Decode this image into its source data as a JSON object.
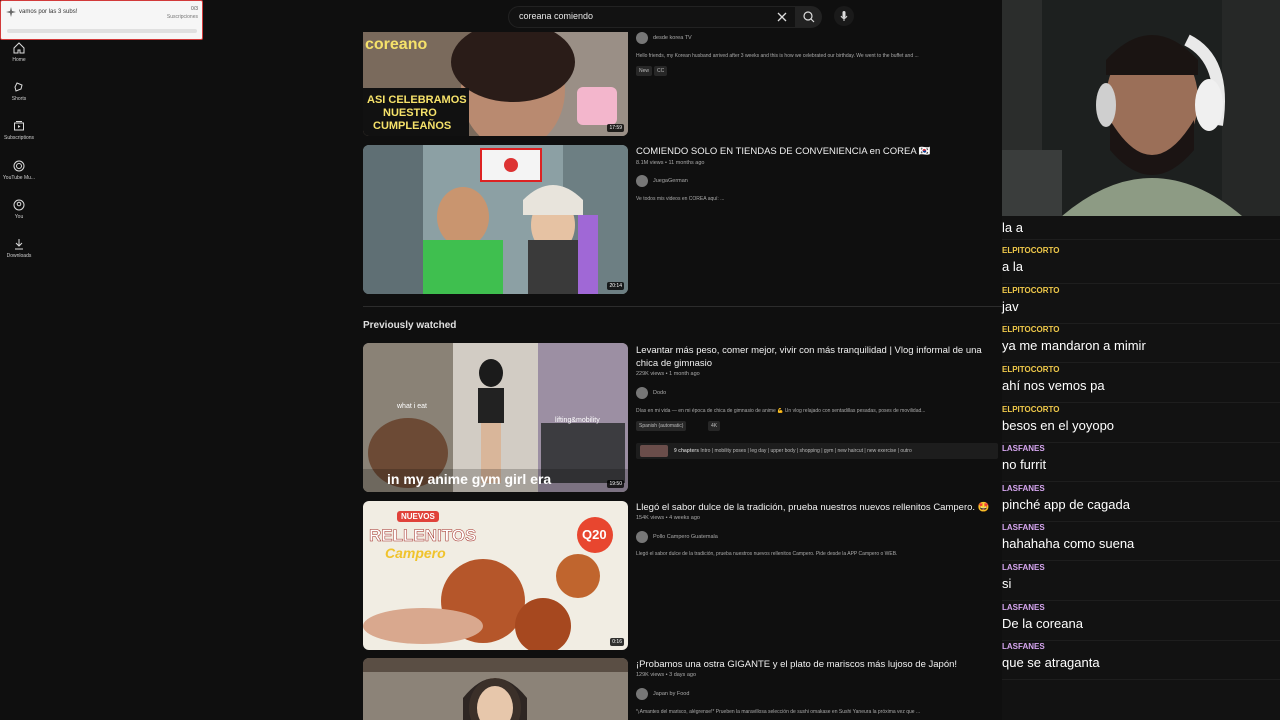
{
  "search": {
    "query": "coreana comiendo"
  },
  "goal": {
    "title": "vamos por las 3 subs!",
    "count": "0/3",
    "label": "Suscripciones"
  },
  "nav": [
    {
      "label": "Home"
    },
    {
      "label": "Shorts"
    },
    {
      "label": "Subscriptions"
    },
    {
      "label": "YouTube Mu..."
    },
    {
      "label": "You"
    },
    {
      "label": "Downloads"
    }
  ],
  "videos": [
    {
      "thumb_text": [
        "coreano",
        "ASI CELEBRAMOS",
        "NUESTRO",
        "CUMPLEAÑOS"
      ],
      "channel": "desde korea TV",
      "description": "Hello friends, my Korean husband arrived after 3 weeks and this is how we celebrated our birthday. We went to the buffet and ...",
      "badges": [
        "New",
        "CC"
      ],
      "duration": "17:59"
    },
    {
      "title": "COMIENDO SOLO EN TIENDAS DE CONVENIENCIA en COREA 🇰🇷",
      "meta": "8.1M views • 11 months ago",
      "channel": "JuegaGerman",
      "description": "Ve todos mis videos en COREA aquí: ...",
      "duration": "20:14"
    }
  ],
  "section_title": "Previously watched",
  "watched": [
    {
      "title": "Levantar más peso, comer mejor, vivir con más tranquilidad | Vlog informal de una chica de gimnasio",
      "meta": "229K views • 1 month ago",
      "channel": "Dodo",
      "description": "Días en mi vida — en mi época de chica de gimnasio de anime 💪 Un vlog relajado con sentadillas pesadas, poses de movilidad...",
      "badges": [
        "Spanish (automatic)",
        "4K"
      ],
      "thumb_text": [
        "what i eat",
        "lifting&mobility",
        "in my anime gym girl era"
      ],
      "chapters_count": "9 chapters",
      "chapters": "Intro | mobility poses | leg day | upper body | shopping | gym | new haircut | new exercise | outro",
      "duration": "19:50"
    },
    {
      "title": "Llegó el sabor dulce de la tradición, prueba nuestros nuevos rellenitos Campero. 🤩",
      "meta": "154K views • 4 weeks ago",
      "channel": "Pollo Campero Guatemala",
      "description": "Llegó el sabor dulce de la tradición, prueba nuestros nuevos rellenitos Campero. Pide desde la APP Campero o WEB.",
      "thumb_text": [
        "NUEVOS",
        "RELLENITOS",
        "Campero",
        "Q20"
      ],
      "duration": "0:16"
    },
    {
      "title": "¡Probamos una ostra GIGANTE y el plato de mariscos más lujoso de Japón!",
      "meta": "129K views • 3 days ago",
      "channel": "Japan by Food",
      "description": "*¡Amantes del marisco, alégrense!* Prueben la maravillosa selección de sushi omakase en Sushi Yaneura la próxima vez que ..."
    }
  ],
  "chat": [
    {
      "user": "",
      "text": "la a"
    },
    {
      "user": "ELPITOCORTO",
      "text": "a la",
      "color": "#f0c94a"
    },
    {
      "user": "ELPITOCORTO",
      "text": "jav",
      "color": "#f0c94a"
    },
    {
      "user": "ELPITOCORTO",
      "text": "ya me mandaron a mimir",
      "color": "#f0c94a"
    },
    {
      "user": "ELPITOCORTO",
      "text": "ahí nos vemos pa",
      "color": "#f0c94a"
    },
    {
      "user": "ELPITOCORTO",
      "text": "besos en el yoyopo",
      "color": "#f0c94a"
    },
    {
      "user": "LASFANES",
      "text": "no furrit",
      "color": "#d6a6f0"
    },
    {
      "user": "LASFANES",
      "text": "pinché app de cagada",
      "color": "#d6a6f0"
    },
    {
      "user": "LASFANES",
      "text": "hahahaha como suena",
      "color": "#d6a6f0"
    },
    {
      "user": "LASFANES",
      "text": "si",
      "color": "#d6a6f0"
    },
    {
      "user": "LASFANES",
      "text": "De la coreana",
      "color": "#d6a6f0"
    },
    {
      "user": "LASFANES",
      "text": "que se atraganta",
      "color": "#d6a6f0"
    }
  ]
}
